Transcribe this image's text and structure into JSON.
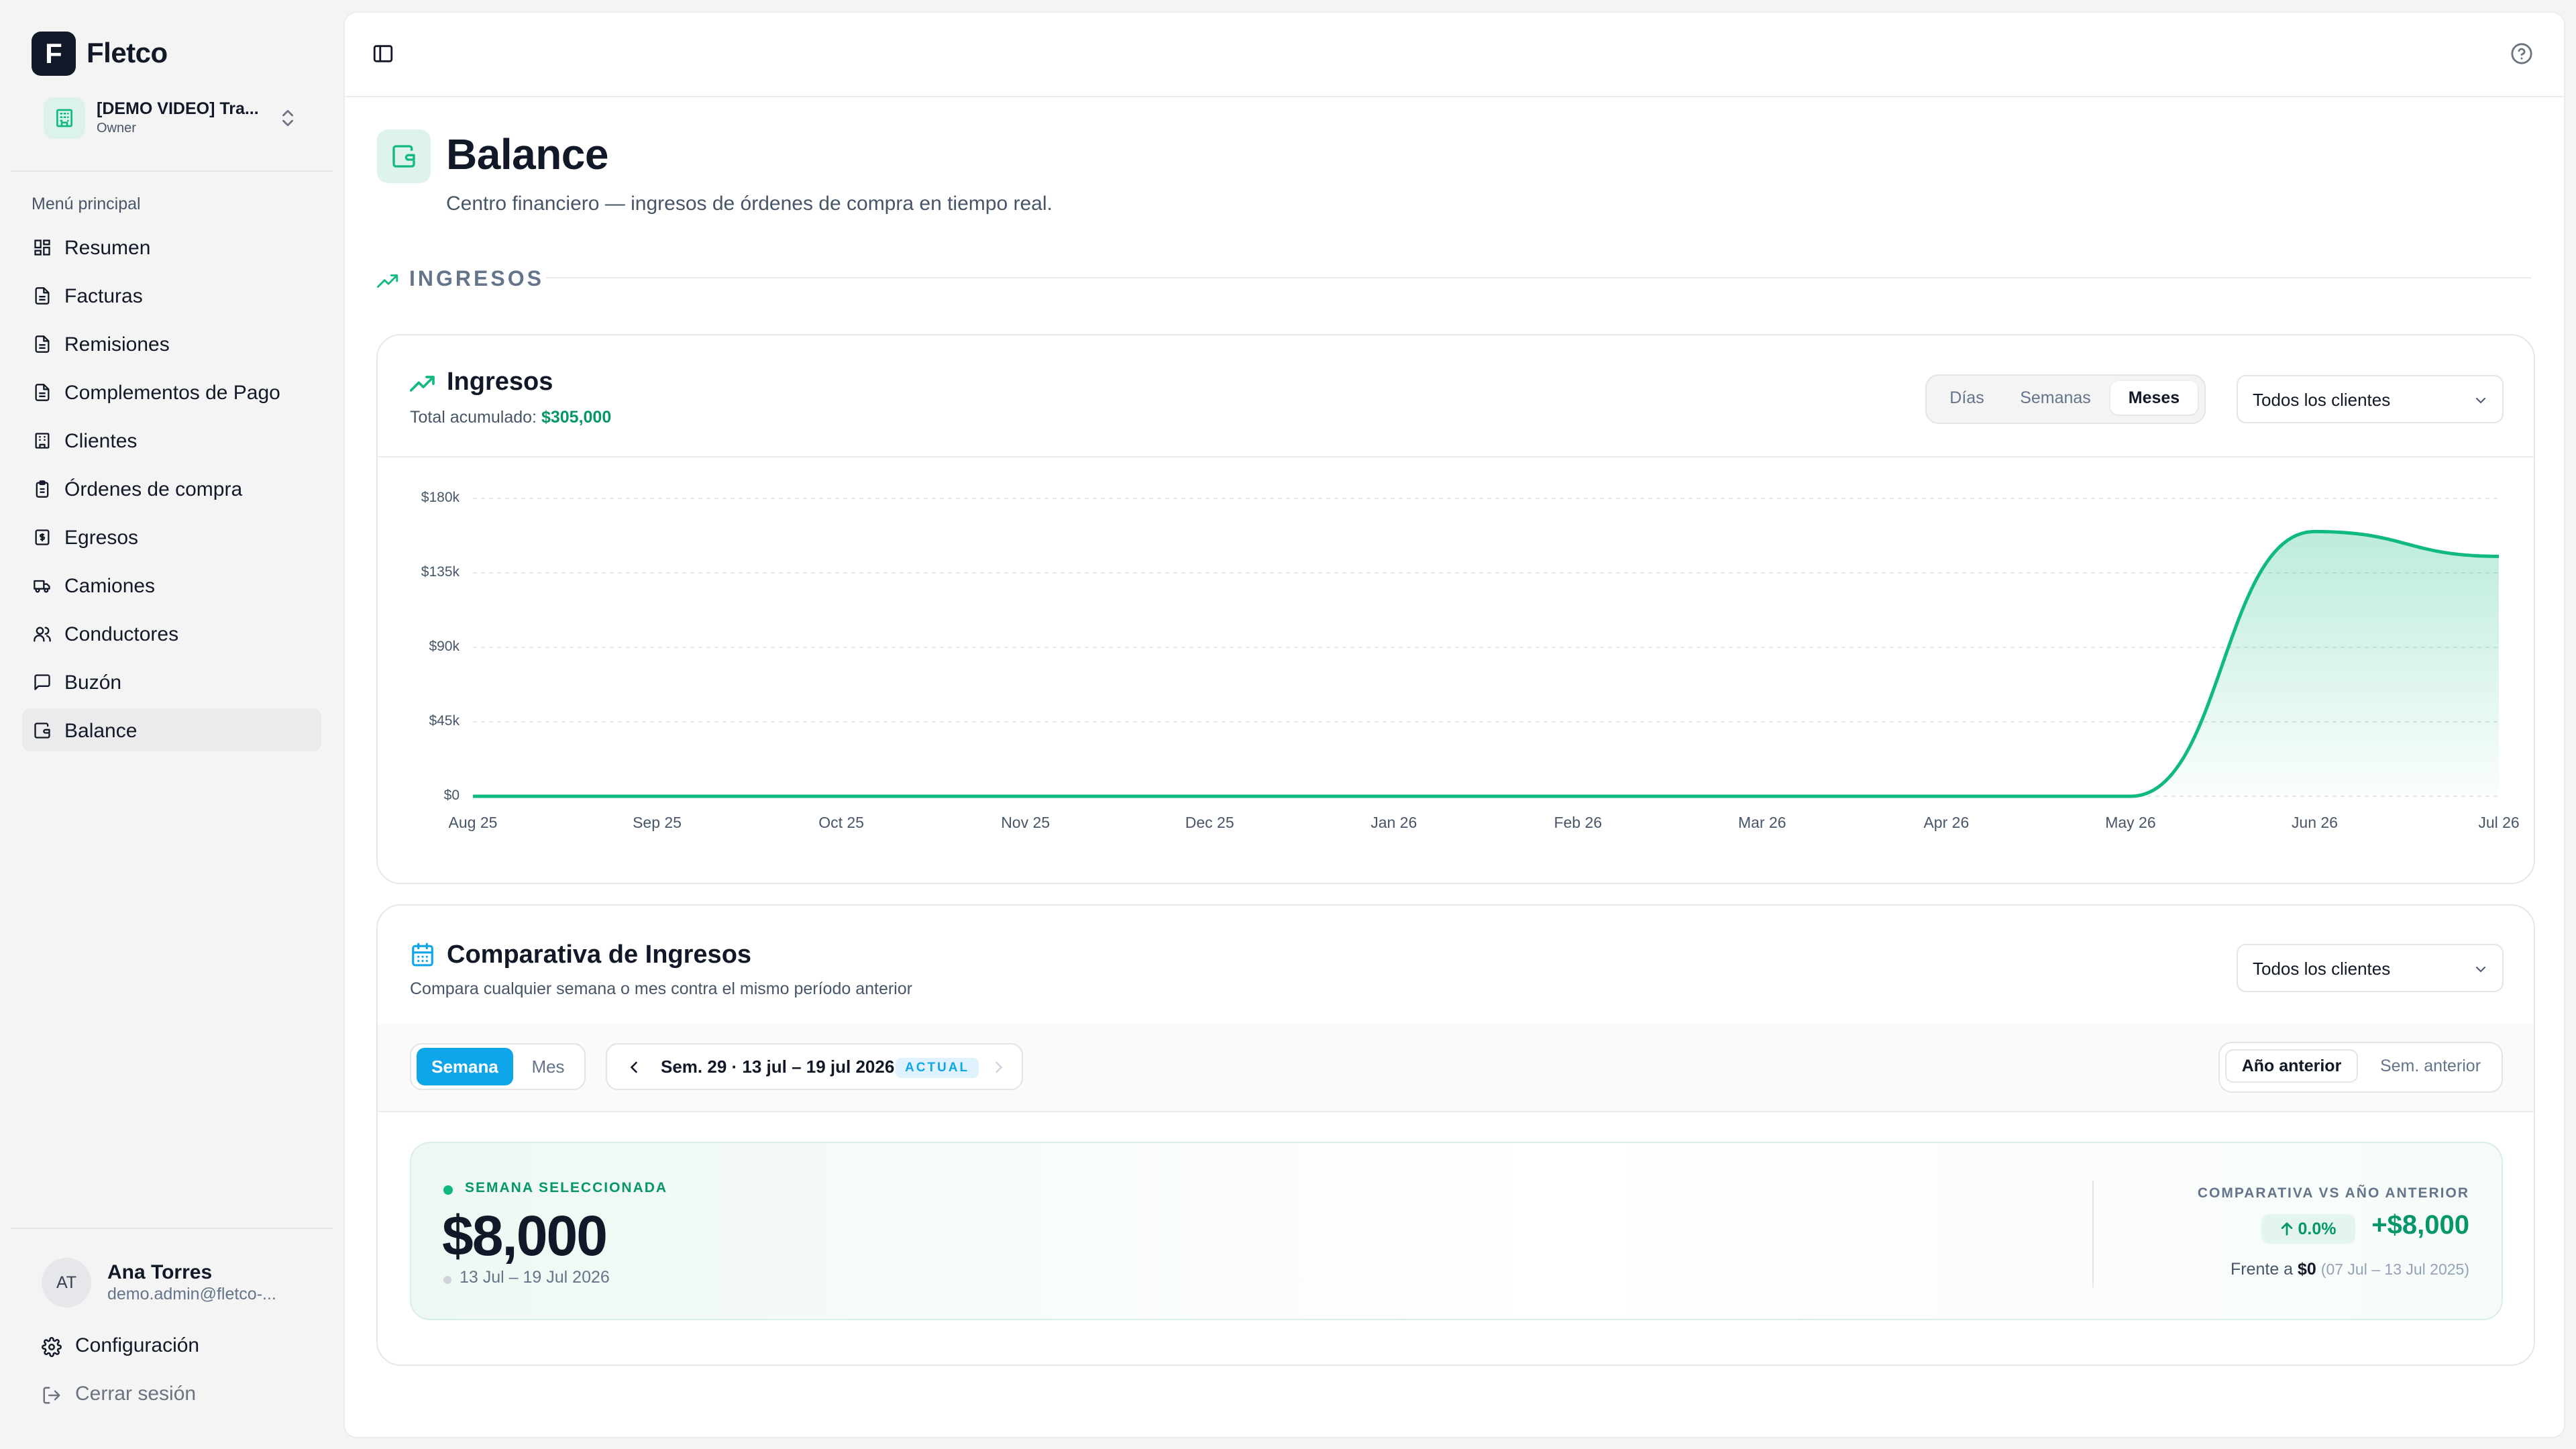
{
  "brand": {
    "logo_letter": "F",
    "name": "Fletco"
  },
  "org": {
    "name": "[DEMO VIDEO] Tra...",
    "role": "Owner"
  },
  "menu": {
    "heading": "Menú principal",
    "items": [
      {
        "label": "Resumen",
        "icon": "dashboard-icon"
      },
      {
        "label": "Facturas",
        "icon": "document-icon"
      },
      {
        "label": "Remisiones",
        "icon": "document-icon"
      },
      {
        "label": "Complementos de Pago",
        "icon": "document-icon"
      },
      {
        "label": "Clientes",
        "icon": "building-icon"
      },
      {
        "label": "Órdenes de compra",
        "icon": "clipboard-icon"
      },
      {
        "label": "Egresos",
        "icon": "receipt-icon"
      },
      {
        "label": "Camiones",
        "icon": "truck-icon"
      },
      {
        "label": "Conductores",
        "icon": "users-icon"
      },
      {
        "label": "Buzón",
        "icon": "message-icon"
      },
      {
        "label": "Balance",
        "icon": "wallet-icon",
        "active": true
      }
    ]
  },
  "user": {
    "initials": "AT",
    "name": "Ana Torres",
    "email": "demo.admin@fletco-..."
  },
  "footer": {
    "settings": "Configuración",
    "logout": "Cerrar sesión"
  },
  "page": {
    "title": "Balance",
    "subtitle": "Centro financiero — ingresos de órdenes de compra en tiempo real.",
    "section": "INGRESOS"
  },
  "income_card": {
    "title": "Ingresos",
    "total_label": "Total acumulado:",
    "total_value": "$305,000",
    "granularity": [
      "Días",
      "Semanas",
      "Meses"
    ],
    "granularity_selected": "Meses",
    "client_filter": "Todos los clientes"
  },
  "chart_data": {
    "type": "area",
    "x": [
      "Aug 25",
      "Sep 25",
      "Oct 25",
      "Nov 25",
      "Dec 25",
      "Jan 26",
      "Feb 26",
      "Mar 26",
      "Apr 26",
      "May 26",
      "Jun 26",
      "Jul 26"
    ],
    "series": [
      {
        "values": [
          0,
          0,
          0,
          0,
          0,
          0,
          0,
          0,
          0,
          0,
          160000,
          145000
        ]
      }
    ],
    "y_ticks": [
      "$0",
      "$45k",
      "$90k",
      "$135k",
      "$180k"
    ],
    "ylim": [
      0,
      180000
    ],
    "grid": true,
    "color": "#10b981"
  },
  "comparison": {
    "title": "Comparativa de Ingresos",
    "subtitle": "Compara cualquier semana o mes contra el mismo período anterior",
    "client_filter": "Todos los clientes",
    "modes": [
      "Semana",
      "Mes"
    ],
    "mode_selected": "Semana",
    "period": "Sem. 29 · 13 jul – 19 jul 2026",
    "period_badge": "ACTUAL",
    "baselines": [
      "Año anterior",
      "Sem. anterior"
    ],
    "baseline_selected": "Año anterior",
    "selected_label": "SEMANA SELECCIONADA",
    "selected_value": "$8,000",
    "selected_range": "13 Jul – 19 Jul 2026",
    "vs_label": "COMPARATIVA VS AÑO ANTERIOR",
    "pct_change": "0.0%",
    "diff": "+$8,000",
    "compare_prefix": "Frente a",
    "compare_value": "$0",
    "compare_range": "(07 Jul – 13 Jul 2025)"
  },
  "colors": {
    "accent": "#10b981",
    "accent_dark": "#059669",
    "primary_blue": "#0ea5e9"
  }
}
